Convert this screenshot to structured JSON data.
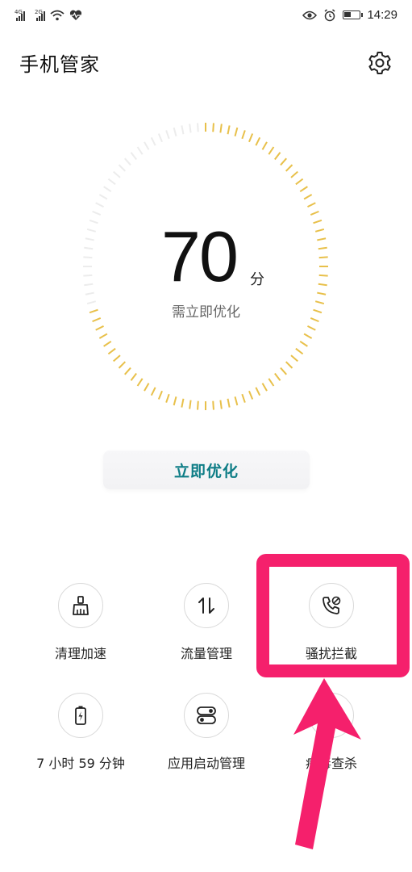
{
  "status_bar": {
    "sim1_tag": "4G",
    "sim2_tag": "2G",
    "time": "14:29",
    "icons": [
      "signal-icon",
      "signal-icon",
      "wifi-icon",
      "heart-rate-icon",
      "eye-icon",
      "alarm-icon",
      "battery-icon"
    ],
    "battery_level": 0.5
  },
  "header": {
    "title": "手机管家",
    "settings_icon": "gear-icon"
  },
  "score": {
    "value": "70",
    "unit": "分",
    "status": "需立即优化",
    "progress": 0.7,
    "accent_color": "#e8c04a"
  },
  "optimize_button": {
    "label": "立即优化",
    "color": "#0e7d86"
  },
  "tools": [
    {
      "label": "清理加速",
      "icon": "broom-icon"
    },
    {
      "label": "流量管理",
      "icon": "data-transfer-icon"
    },
    {
      "label": "骚扰拦截",
      "icon": "blocked-call-icon"
    },
    {
      "label": "7 小时 59 分钟",
      "icon": "battery-charging-icon"
    },
    {
      "label": "应用启动管理",
      "icon": "toggle-switches-icon"
    },
    {
      "label": "病毒查杀",
      "icon": "virus-scan-icon"
    }
  ],
  "annotation": {
    "highlight_color": "#f5206c"
  }
}
